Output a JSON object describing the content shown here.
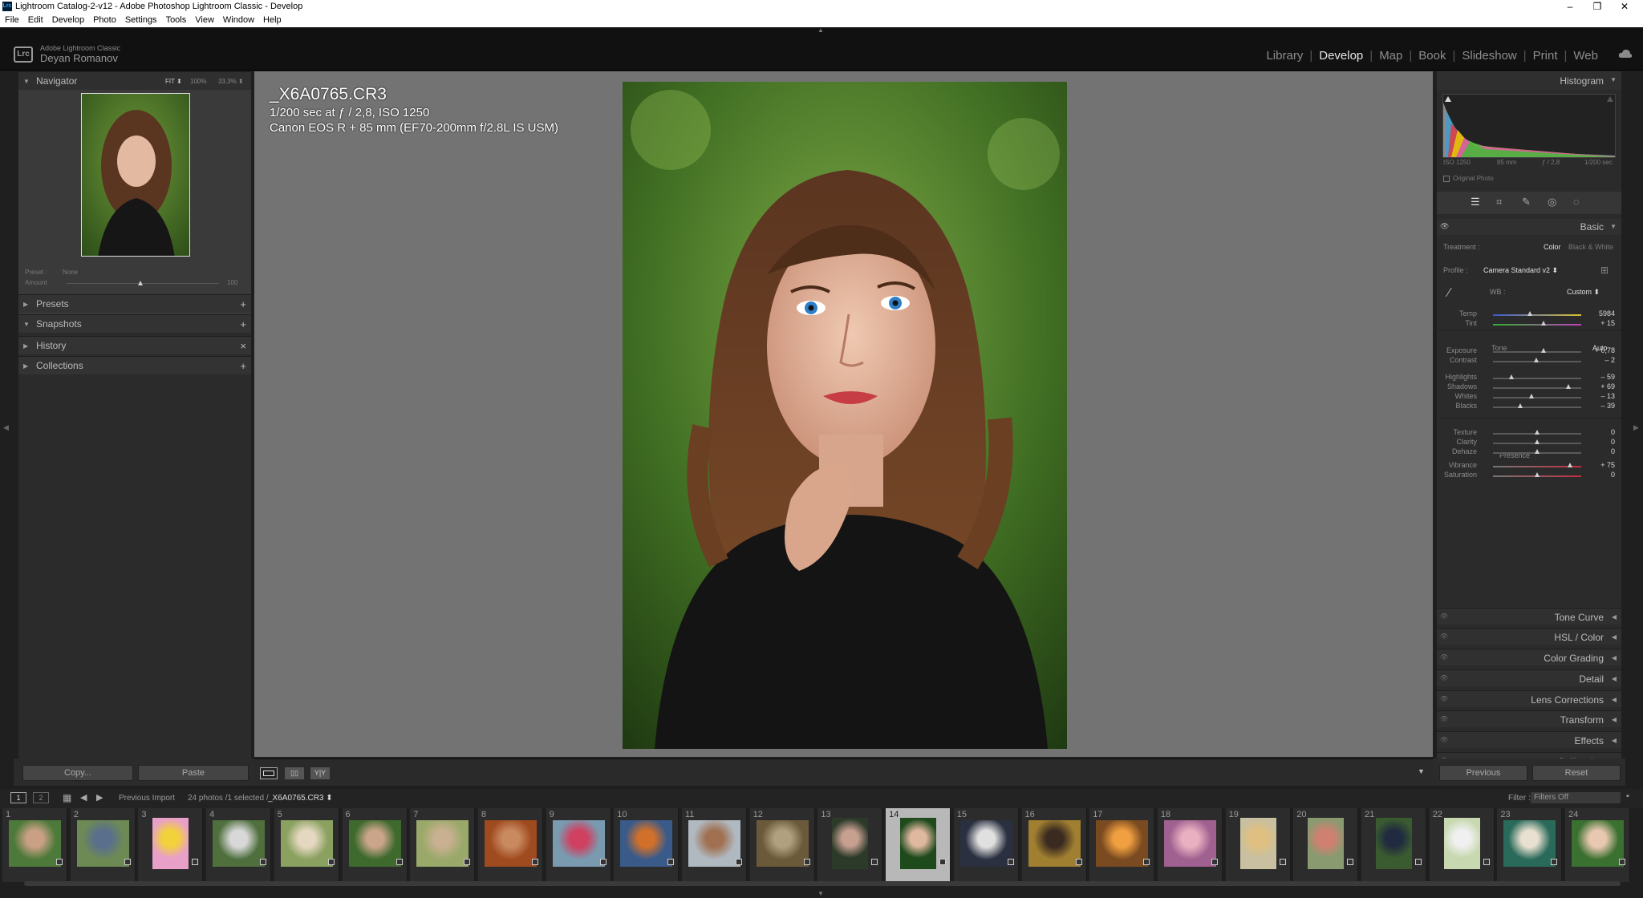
{
  "titlebar": {
    "title": "Lightroom Catalog-2-v12 - Adobe Photoshop Lightroom Classic - Develop",
    "app_icon": "Lrc",
    "min": "–",
    "max": "❐",
    "close": "✕"
  },
  "menubar": [
    "File",
    "Edit",
    "Develop",
    "Photo",
    "Settings",
    "Tools",
    "View",
    "Window",
    "Help"
  ],
  "identity": {
    "logo": "Lrc",
    "product": "Adobe Lightroom Classic",
    "user": "Deyan Romanov"
  },
  "modules": [
    "Library",
    "Develop",
    "Map",
    "Book",
    "Slideshow",
    "Print",
    "Web"
  ],
  "active_module": "Develop",
  "navigator": {
    "title": "Navigator",
    "zoom": [
      "FIT ⬍",
      "100%",
      "33.3% ⬍"
    ],
    "preset_label": "Preset :",
    "preset_value": "None",
    "amount_label": "Amount",
    "amount_value": "100"
  },
  "left_sections": [
    {
      "label": "Presets",
      "action": "+"
    },
    {
      "label": "Snapshots",
      "action": "+"
    },
    {
      "label": "History",
      "action": "×"
    },
    {
      "label": "Collections",
      "action": "+"
    }
  ],
  "left_buttons": {
    "copy": "Copy...",
    "paste": "Paste"
  },
  "photo_info": {
    "filename": "_X6A0765.CR3",
    "exposure": "1/200 sec at ƒ / 2,8, ISO 1250",
    "lens": "Canon EOS R + 85 mm (EF70-200mm f/2.8L IS USM)"
  },
  "histogram": {
    "title": "Histogram",
    "iso": "ISO 1250",
    "focal": "85 mm",
    "aperture": "ƒ / 2,8",
    "shutter": "1/200 sec",
    "original_photo": "Original Photo"
  },
  "basic": {
    "title": "Basic",
    "treatment_label": "Treatment :",
    "treatment_color": "Color",
    "treatment_bw": "Black & White",
    "profile_label": "Profile :",
    "profile_value": "Camera Standard v2 ⬍",
    "wb_label": "WB :",
    "wb_value": "Custom ⬍",
    "tone_label": "Tone",
    "auto_label": "Auto",
    "presence_label": "Presence",
    "sliders": [
      {
        "label": "Temp",
        "value": "5984",
        "pos": 0.42
      },
      {
        "label": "Tint",
        "value": "+ 15",
        "pos": 0.57
      },
      {
        "label": "Exposure",
        "value": "+ 0,78",
        "pos": 0.57
      },
      {
        "label": "Contrast",
        "value": "– 2",
        "pos": 0.49
      },
      {
        "label": "Highlights",
        "value": "– 59",
        "pos": 0.21
      },
      {
        "label": "Shadows",
        "value": "+ 69",
        "pos": 0.85
      },
      {
        "label": "Whites",
        "value": "– 13",
        "pos": 0.44
      },
      {
        "label": "Blacks",
        "value": "– 39",
        "pos": 0.31
      },
      {
        "label": "Texture",
        "value": "0",
        "pos": 0.5
      },
      {
        "label": "Clarity",
        "value": "0",
        "pos": 0.5
      },
      {
        "label": "Dehaze",
        "value": "0",
        "pos": 0.5
      },
      {
        "label": "Vibrance",
        "value": "+ 75",
        "pos": 0.87
      },
      {
        "label": "Saturation",
        "value": "0",
        "pos": 0.5
      }
    ]
  },
  "right_sections": [
    "Tone Curve",
    "HSL / Color",
    "Color Grading",
    "Detail",
    "Lens Corrections",
    "Transform",
    "Effects",
    "Calibration"
  ],
  "right_buttons": {
    "previous": "Previous",
    "reset": "Reset"
  },
  "filmstrip_bar": {
    "source": "Previous Import",
    "count": "24 photos /1 selected /",
    "file": "_X6A0765.CR3 ⬍",
    "filter_label": "Filter :",
    "filter_value": "Filters Off"
  },
  "filmstrip": {
    "numbers": [
      "1",
      "2",
      "3",
      "4",
      "5",
      "6",
      "7",
      "8",
      "9",
      "10",
      "11",
      "12",
      "13",
      "14",
      "15",
      "16",
      "17",
      "18",
      "19",
      "20",
      "21",
      "22",
      "23",
      "24"
    ],
    "selected_index": 13
  },
  "colors": {
    "accent_selected": "#b8b8b8",
    "panel": "#2b2b2b",
    "center": "#737373"
  }
}
